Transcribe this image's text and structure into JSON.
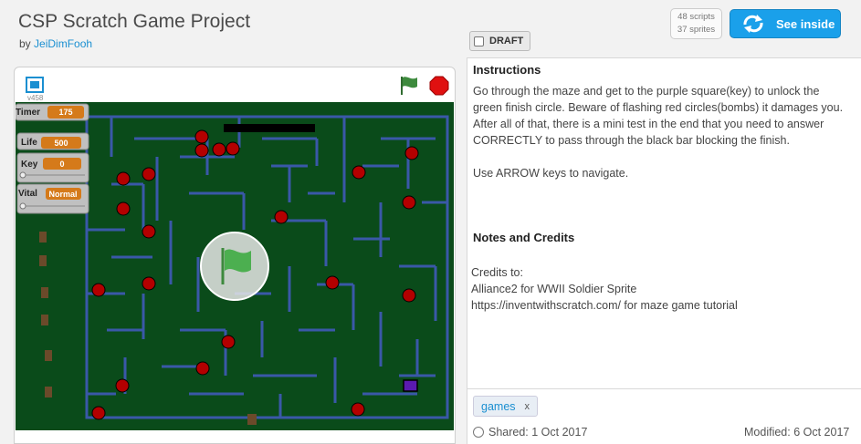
{
  "header": {
    "title": "CSP Scratch Game Project",
    "by_prefix": "by",
    "author": "JeiDimFooh",
    "stats": {
      "scripts": "48 scripts",
      "sprites": "37 sprites"
    },
    "see_inside_label": "See inside",
    "draft_label": "DRAFT"
  },
  "player": {
    "version": "v458",
    "monitors": [
      {
        "label": "Timer",
        "value": "175"
      },
      {
        "label": "Life",
        "value": "500"
      },
      {
        "label": "Key",
        "value": "0"
      },
      {
        "label": "Vital",
        "value": "Normal"
      }
    ]
  },
  "instructions": {
    "heading": "Instructions",
    "body": "Go through the maze and get to the purple square(key) to unlock the green finish circle. Beware of flashing red circles(bombs) it damages you. After all of that, there is a mini test in the end that you need to answer CORRECTLY to pass through the black bar blocking the finish.",
    "controls": "Use ARROW keys to navigate."
  },
  "notes": {
    "heading": "Notes and Credits",
    "credits_label": "Credits to:",
    "credit_1": "Alliance2 for WWII Soldier Sprite",
    "credit_2": "https://inventwithscratch.com/ for maze game tutorial"
  },
  "tags": [
    {
      "label": "games",
      "remove": "x"
    }
  ],
  "footer": {
    "shared": "Shared: 1 Oct 2017",
    "modified": "Modified: 6 Oct 2017"
  },
  "colors": {
    "maze_bg": "#0a4b1a",
    "maze_wall": "#3a58a8",
    "bomb": "#b30000",
    "key_purple": "#5a1ab0",
    "accent": "#1aa0ea"
  }
}
